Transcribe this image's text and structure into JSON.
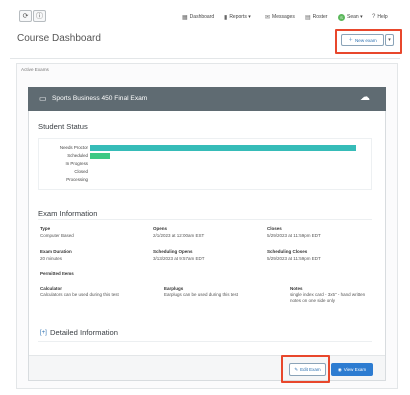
{
  "topbar": {
    "refresh_icon": "refresh-icon",
    "info_icon": "info-icon",
    "nav": [
      {
        "label": "Dashboard",
        "icon": "building-icon"
      },
      {
        "label": "Reports ▾",
        "icon": "bar-chart-icon"
      },
      {
        "label": "Messages",
        "icon": "envelope-icon"
      },
      {
        "label": "Roster",
        "icon": "grid-icon"
      },
      {
        "label": "Sean ▾",
        "icon": "user-avatar-icon"
      },
      {
        "label": "Help",
        "icon": "help-icon"
      }
    ]
  },
  "page": {
    "title": "Course Dashboard",
    "new_exam_label": "New exam",
    "highlight_color": "#e8472c"
  },
  "panel": {
    "label": "Active Exams"
  },
  "exam": {
    "title": "Sports Business 450 Final Exam",
    "header_color": "#5f6b72",
    "student_status": {
      "heading": "Student Status",
      "chart_data": {
        "type": "bar",
        "orientation": "horizontal",
        "categories": [
          "Needs Proctor",
          "Scheduled",
          "In Progress",
          "Closed",
          "Processing"
        ],
        "values": [
          0.95,
          0.07,
          0,
          0,
          0
        ],
        "colors": [
          "#36bcb8",
          "#3cc983",
          "#36bcb8",
          "#36bcb8",
          "#36bcb8"
        ]
      }
    },
    "info": {
      "heading": "Exam Information",
      "type_label": "Type",
      "type_value": "Computer Based",
      "opens_label": "Opens",
      "opens_value": "2/1/2023 at 12:00am EST",
      "closes_label": "Closes",
      "closes_value": "5/29/2023 at 11:59pm EDT",
      "duration_label": "Exam Duration",
      "duration_value": "20 minutes",
      "sched_opens_label": "Scheduling Opens",
      "sched_opens_value": "3/13/2023 at 9:57am EDT",
      "sched_closes_label": "Scheduling Closes",
      "sched_closes_value": "5/29/2023 at 11:59pm EDT",
      "permitted_label": "Permitted Items",
      "calc_label": "Calculator",
      "calc_value": "Calculators can be used during this test",
      "earplugs_label": "Earplugs",
      "earplugs_value": "Earplugs can be used during this test",
      "notes_label": "Notes",
      "notes_value": "single index card - 3x5\" - hand written notes on one side only"
    },
    "detailed": {
      "toggle": "[+]",
      "heading": "Detailed Information"
    },
    "footer": {
      "edit_label": "Edit Exam",
      "view_label": "View Exam"
    }
  }
}
